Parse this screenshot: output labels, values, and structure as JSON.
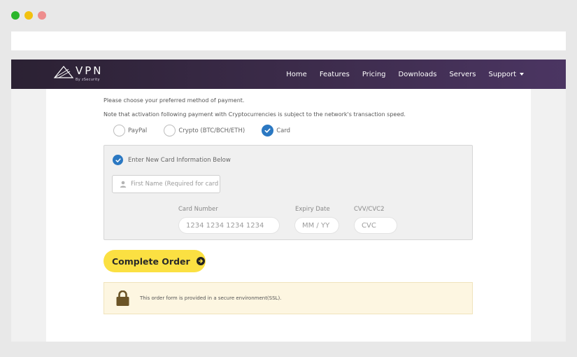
{
  "window": {
    "controls": [
      "green",
      "yellow",
      "red"
    ]
  },
  "navbar": {
    "logo_text": "VPN",
    "logo_subtext": "By zSecurity",
    "items": [
      {
        "label": "Home"
      },
      {
        "label": "Features"
      },
      {
        "label": "Pricing"
      },
      {
        "label": "Downloads"
      },
      {
        "label": "Servers"
      },
      {
        "label": "Support",
        "has_dropdown": true
      }
    ]
  },
  "payment": {
    "intro": "Please choose your preferred method of payment.",
    "note": "Note that activation following payment with Cryptocurrencies is subject to the network's transaction speed.",
    "methods": [
      {
        "label": "PayPal",
        "selected": false
      },
      {
        "label": "Crypto (BTC/BCH/ETH)",
        "selected": false
      },
      {
        "label": "Card",
        "selected": true
      }
    ]
  },
  "card_form": {
    "enter_new_label": "Enter New Card Information Below",
    "enter_new_checked": true,
    "first_name_placeholder": "First Name (Required for card",
    "card_number_label": "Card Number",
    "card_number_placeholder": "1234 1234 1234 1234",
    "expiry_label": "Expiry Date",
    "expiry_placeholder": "MM / YY",
    "cvv_label": "CVV/CVC2",
    "cvv_placeholder": "CVC"
  },
  "actions": {
    "complete_order_label": "Complete Order"
  },
  "security_notice": {
    "text": "This order form is provided in a secure environment(SSL)."
  },
  "colors": {
    "nav_start": "#2b2133",
    "nav_end": "#4b3562",
    "accent_blue": "#2b78c2",
    "button_yellow": "#fbe042",
    "notice_bg": "#fdf6e1"
  }
}
